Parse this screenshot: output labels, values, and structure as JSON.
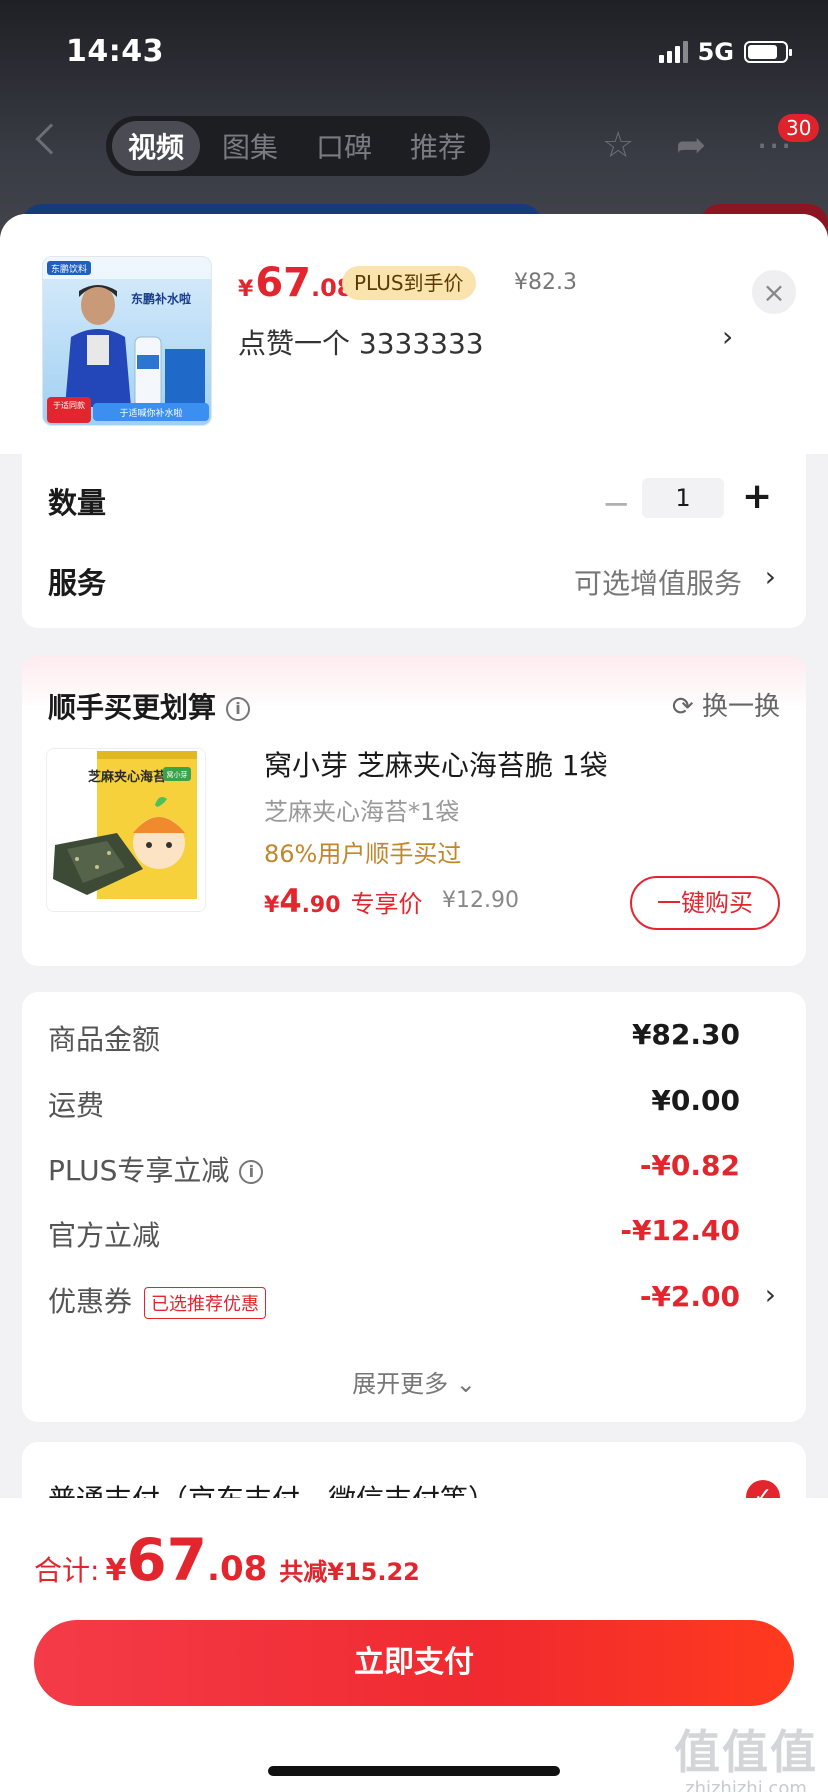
{
  "status": {
    "time": "14:43",
    "network": "5G"
  },
  "nav": {
    "tabs": [
      "视频",
      "图集",
      "口碑",
      "推荐"
    ],
    "active_tab": 0,
    "badge": "30"
  },
  "product": {
    "currency": "¥",
    "price_int": "67",
    "price_dec": ".08",
    "plus_tag": "PLUS到手价",
    "original_price": "¥82.3",
    "variant": "点赞一个  3333333",
    "thumb_brand": "东鹏饮料",
    "thumb_title": "东鹏补水啦",
    "thumb_tag1": "于适同款",
    "thumb_tag2": "于适喊你补水啦"
  },
  "quantity": {
    "label": "数量",
    "value": "1"
  },
  "service": {
    "label": "服务",
    "value": "可选增值服务"
  },
  "recommend": {
    "title": "顺手买更划算",
    "swap": "换一换",
    "name": "窝小芽 芝麻夹心海苔脆 1袋",
    "sub": "芝麻夹心海苔*1袋",
    "percent": "86%用户顺手买过",
    "price_cur": "¥",
    "price_int": "4",
    "price_dec": ".90",
    "price_tag": "专享价",
    "orig": "¥12.90",
    "buy": "一键购买",
    "pack_title": "芝麻夹心海苔",
    "pack_brand": "窝小芽"
  },
  "amounts": {
    "rows": [
      {
        "label": "商品金额",
        "value": "¥82.30"
      },
      {
        "label": "运费",
        "value": "¥0.00"
      },
      {
        "label": "PLUS专享立减",
        "value": "-¥0.82"
      },
      {
        "label": "官方立减",
        "value": "-¥12.40"
      },
      {
        "label": "优惠券",
        "value": "-¥2.00"
      }
    ],
    "coupon_tag": "已选推荐优惠",
    "expand": "展开更多"
  },
  "payment": {
    "label": "普通支付（京东支付、微信支付等）"
  },
  "total": {
    "label": "合计:",
    "cur": "¥",
    "int": "67",
    "dec": ".08",
    "save": "共减¥15.22",
    "button": "立即支付"
  },
  "watermark": {
    "big": "值值值",
    "small": "zhizhizhi.com"
  }
}
